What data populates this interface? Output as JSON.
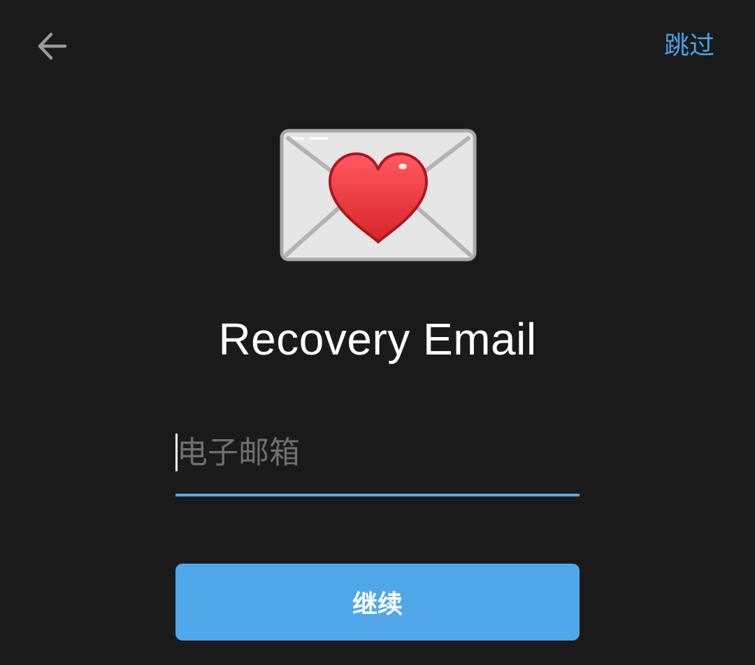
{
  "header": {
    "back_icon": "arrow-left-icon",
    "skip_label": "跳过"
  },
  "hero": {
    "icon": "love-letter-icon"
  },
  "title": "Recovery Email",
  "email": {
    "placeholder": "电子邮箱",
    "value": ""
  },
  "actions": {
    "continue_label": "继续"
  },
  "colors": {
    "background": "#1a1a1a",
    "accent": "#50a7e8",
    "placeholder": "#6f6f6f",
    "text": "#ffffff"
  }
}
